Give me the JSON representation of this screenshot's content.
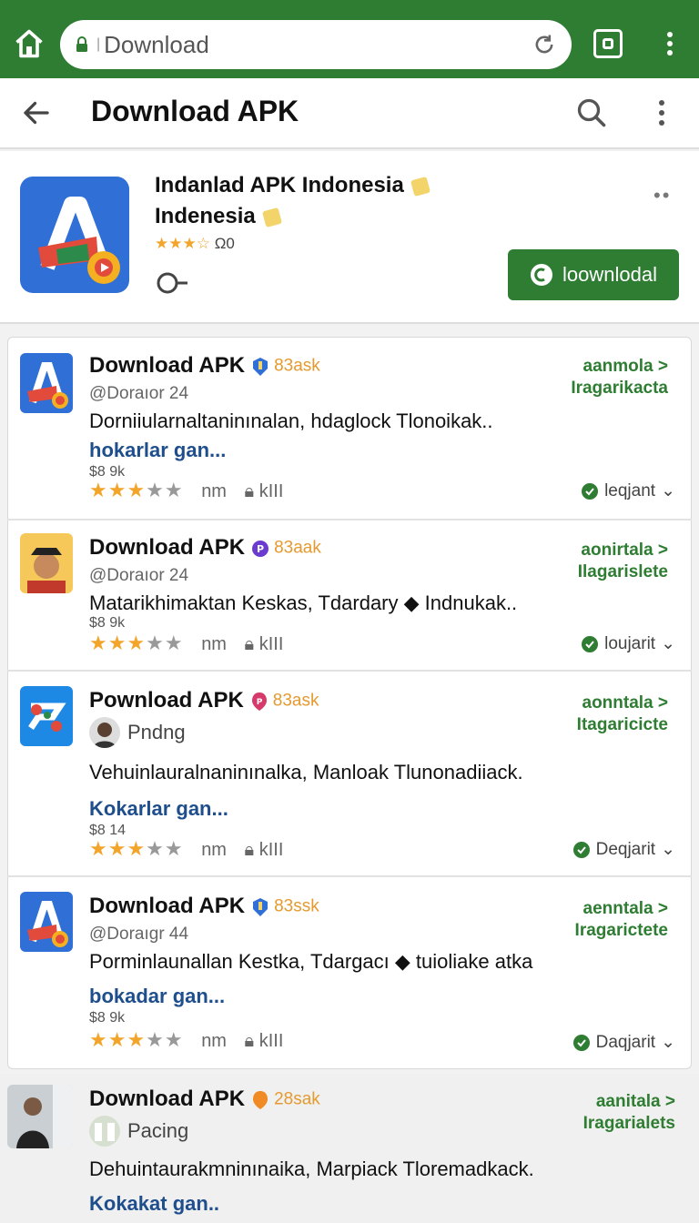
{
  "browser": {
    "url_separator": "|",
    "url_text": "Download"
  },
  "appbar": {
    "title": "Download APK"
  },
  "featured": {
    "name": "Indanlad APK Indonesia",
    "subtitle": "Indenesia",
    "rating_stars": "★★★☆",
    "rating_count": "Ω0",
    "more": "••",
    "download_label": "loownlodal"
  },
  "items": [
    {
      "title": "Download APK",
      "tag": "83ask",
      "developer": "@Doraıor 24",
      "description": "Dorniiularnaltaninınalan, hdaglock Tlonoikak..",
      "link": "hokarlar gan...",
      "size": "$8 9k",
      "rating_text": "nm",
      "installs": "kIII",
      "right_line1": "aanmola >",
      "right_line2": "Iragarikacta",
      "status": "leqjant"
    },
    {
      "title": "Download APK",
      "tag": "83aak",
      "developer": "@Doraıor 24",
      "description": "Matarikhimaktan Keskas, Tdardary ◆ Indnukak..",
      "link": "",
      "size": "$8 9k",
      "rating_text": "nm",
      "installs": "kIII",
      "right_line1": "aonirtala >",
      "right_line2": "Ilagarislete",
      "status": "loujarit"
    },
    {
      "title": "Pownload APK",
      "tag": "83ask",
      "developer": "Pndng",
      "description": "Vehuinlauralnaninınalka, Manloak Tlunonadiiack.",
      "link": "Kokarlar gan...",
      "size": "$8 14",
      "rating_text": "nm",
      "installs": "kIII",
      "right_line1": "aonntala >",
      "right_line2": "Itagaricicte",
      "status": "Deqjarit"
    },
    {
      "title": "Download APK",
      "tag": "83ssk",
      "developer": "@Doraıgr 44",
      "description": "Porminlaunallan Kestka, Tdargacı ◆ tuioliake atka",
      "link": "bokadar gan...",
      "size": "$8 9k",
      "rating_text": "nm",
      "installs": "kIII",
      "right_line1": "aenntala >",
      "right_line2": "Iragarictete",
      "status": "Daqjarit"
    },
    {
      "title": "Download APK",
      "tag": "28sak",
      "developer": "Pacing",
      "description": "Dehuintaurakmninınaika, Marpiack Tloremadkack.",
      "link": "Kokakat gan..",
      "size": "",
      "rating_text": "",
      "installs": "",
      "right_line1": "aanitala >",
      "right_line2": "Iragarialets",
      "status": ""
    }
  ],
  "colors": {
    "brand_green": "#2e7d32",
    "star": "#f2a52a",
    "link_blue": "#1f4e8c",
    "tag_orange": "#e59a2f"
  },
  "icons": [
    "home-icon",
    "lock-icon",
    "reload-icon",
    "tabs-icon",
    "menu-dots-icon",
    "back-arrow-icon",
    "search-icon",
    "more-vert-icon",
    "key-icon",
    "download-icon",
    "status-check-icon",
    "star-icon",
    "lock-small-icon"
  ]
}
